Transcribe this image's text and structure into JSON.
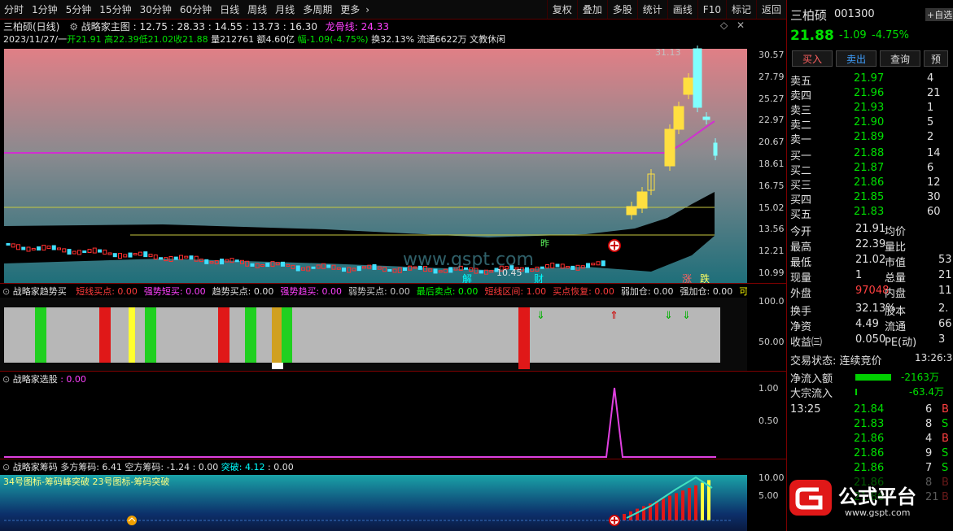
{
  "toolbar": {
    "periods": [
      "分时",
      "1分钟",
      "5分钟",
      "15分钟",
      "30分钟",
      "60分钟",
      "日线",
      "周线",
      "月线",
      "多周期",
      "更多"
    ],
    "tools": [
      "复权",
      "叠加",
      "多股",
      "统计",
      "画线",
      "F10",
      "标记",
      "返回"
    ]
  },
  "main": {
    "stock_title": "三柏硕(日线)",
    "chart_name": "战略家主图",
    "values": ": 12.75 : 28.33 : 14.55 : 13.73 : 16.30",
    "dragon_label": "龙骨线: 24.33",
    "info": {
      "date": "2023/11/27/一",
      "open": "开21.91",
      "high": "高22.39",
      "low": "低21.02",
      "close": "收21.88",
      "vol": "量212761",
      "amount": "额4.60亿",
      "change": "幅-1.09(-4.75%)",
      "turnover": "换32.13%",
      "float": "流通6622万",
      "sector": "文教休闲"
    },
    "yticks": [
      "30.57",
      "27.79",
      "25.27",
      "22.97",
      "20.67",
      "18.61",
      "16.75",
      "15.02",
      "13.56",
      "12.21",
      "10.99"
    ],
    "high_label": "31.13",
    "low_label": "10.45",
    "mark_jie": "解",
    "mark_cai": "财",
    "mark_zhang": "涨",
    "mark_die": "跌",
    "mark_zuo": "昨"
  },
  "panel2": {
    "title": "战略家趋势买",
    "items": [
      {
        "label": "短线买点: 0.00",
        "color": "#ff3b3b"
      },
      {
        "label": "强势短买: 0.00",
        "color": "#ff40ff"
      },
      {
        "label": "趋势买点: 0.00",
        "color": "#e0e0e0"
      },
      {
        "label": "强势趋买: 0.00",
        "color": "#ff40ff"
      },
      {
        "label": "弱势买点: 0.00",
        "color": "#cccccc"
      },
      {
        "label": "最后卖点: 0.00",
        "color": "#00ff00"
      },
      {
        "label": "短线区间: 1.00",
        "color": "#ff3b3b"
      },
      {
        "label": "买点恢复: 0.00",
        "color": "#ff3b3b"
      },
      {
        "label": "弱加仓: 0.00",
        "color": "#e0e0e0"
      },
      {
        "label": "强加仓: 0.00",
        "color": "#e0e0e0"
      },
      {
        "label": "可",
        "color": "#ffff00"
      }
    ],
    "yticks": [
      "100.0",
      "50.00"
    ]
  },
  "panel3": {
    "title": "战略家选股",
    "value": ": 0.00",
    "yticks": [
      "1.00",
      "0.50"
    ]
  },
  "panel4": {
    "title": "战略家筹码",
    "long": "多方筹码: 6.41",
    "short": "空方筹码: -1.24",
    "v3": ": 0.00",
    "breakout": "突破: 4.12",
    "v5": ": 0.00",
    "legend": "34号图标-筹码峰突破  23号图标-筹码突破",
    "yticks": [
      "10.00",
      "5.00"
    ]
  },
  "quote": {
    "name": "三柏硕",
    "code": "001300",
    "price": "21.88",
    "change": "-1.09",
    "pct": "-4.75%",
    "self_select": "+自选",
    "buttons": [
      "买入",
      "卖出",
      "查询",
      "预"
    ],
    "asks": [
      {
        "label": "卖五",
        "price": "21.97",
        "vol": "4"
      },
      {
        "label": "卖四",
        "price": "21.96",
        "vol": "21"
      },
      {
        "label": "卖三",
        "price": "21.93",
        "vol": "1"
      },
      {
        "label": "卖二",
        "price": "21.90",
        "vol": "5"
      },
      {
        "label": "卖一",
        "price": "21.89",
        "vol": "2"
      }
    ],
    "bids": [
      {
        "label": "买一",
        "price": "21.88",
        "vol": "14"
      },
      {
        "label": "买二",
        "price": "21.87",
        "vol": "6"
      },
      {
        "label": "买三",
        "price": "21.86",
        "vol": "12"
      },
      {
        "label": "买四",
        "price": "21.85",
        "vol": "30"
      },
      {
        "label": "买五",
        "price": "21.83",
        "vol": "60"
      }
    ],
    "stats": [
      {
        "l1": "今开",
        "v1": "21.91",
        "l2": "均价",
        "v2": ""
      },
      {
        "l1": "最高",
        "v1": "22.39",
        "l2": "量比",
        "v2": ""
      },
      {
        "l1": "最低",
        "v1": "21.02",
        "l2": "市值",
        "v2": "53"
      },
      {
        "l1": "现量",
        "v1": "1",
        "l2": "总量",
        "v2": "21"
      },
      {
        "l1": "外盘",
        "v1": "97048",
        "l2": "内盘",
        "v2": "11"
      }
    ],
    "fin": [
      {
        "l1": "换手",
        "v1": "32.13%",
        "l2": "股本",
        "v2": "2."
      },
      {
        "l1": "净资",
        "v1": "4.49",
        "l2": "流通",
        "v2": "66"
      },
      {
        "l1": "收益㈢",
        "v1": "0.050",
        "l2": "PE(动)",
        "v2": "3"
      }
    ],
    "status_label": "交易状态: 连续竞价",
    "status_time": "13:26:33",
    "netflow_label": "净流入额",
    "netflow_value": "-2163万",
    "bigflow_label": "大宗流入",
    "bigflow_value": "-63.4万",
    "ticks": [
      {
        "time": "13:25",
        "price": "21.84",
        "vol": "6",
        "bs": "B"
      },
      {
        "time": "",
        "price": "21.83",
        "vol": "8",
        "bs": "S"
      },
      {
        "time": "",
        "price": "21.86",
        "vol": "4",
        "bs": "B"
      },
      {
        "time": "",
        "price": "21.86",
        "vol": "9",
        "bs": "S"
      },
      {
        "time": "",
        "price": "21.86",
        "vol": "7",
        "bs": "S"
      },
      {
        "time": "",
        "price": "21.86",
        "vol": "8",
        "bs": "B"
      },
      {
        "time": "",
        "price": "21.86",
        "vol": "21",
        "bs": "B"
      }
    ]
  },
  "logo": {
    "text": "公式平台",
    "url": "www.gspt.com"
  },
  "watermark": "www.gspt.com"
}
